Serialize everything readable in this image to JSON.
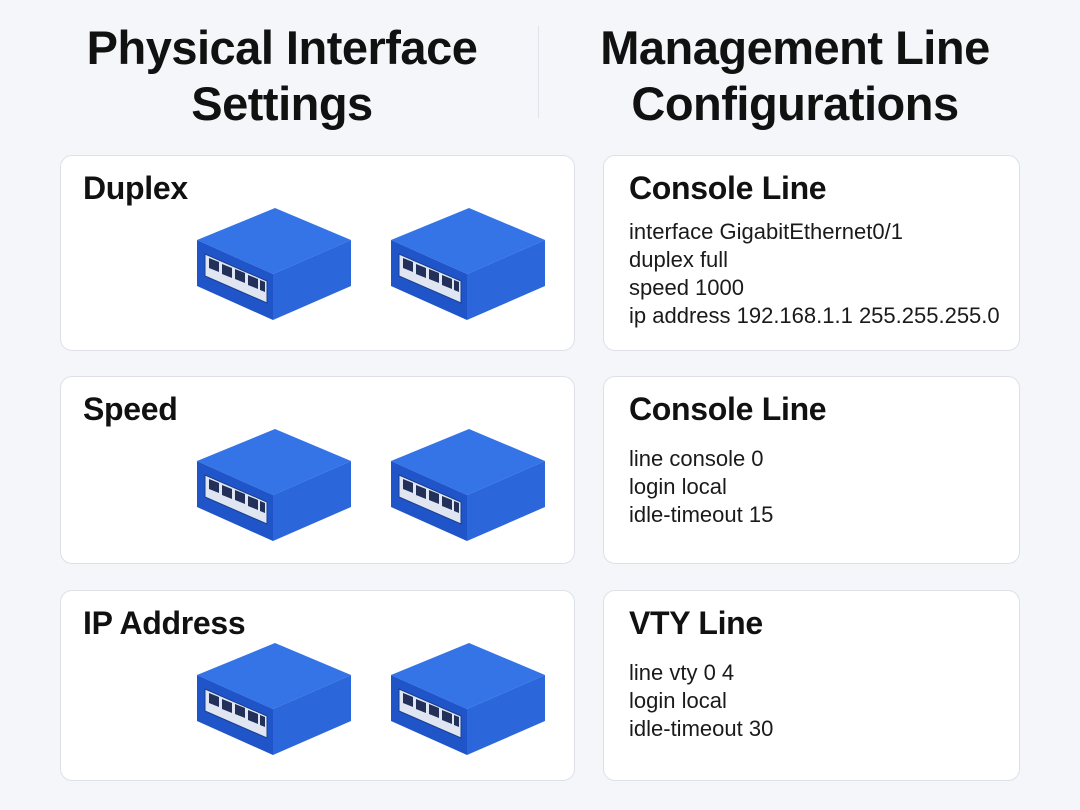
{
  "header": {
    "left_title_line1": "Physical Interface",
    "left_title_line2": "Settings",
    "right_title_line1": "Management Line",
    "right_title_line2": "Configurations"
  },
  "left_cards": [
    {
      "label": "Duplex",
      "icon": "network-switch-icon"
    },
    {
      "label": "Speed",
      "icon": "network-switch-icon"
    },
    {
      "label": "IP Address",
      "icon": "network-switch-icon"
    }
  ],
  "right_cards": [
    {
      "label": "Console Line",
      "lines": [
        "interface GigabitEthernet0/1",
        "duplex full",
        "speed 1000",
        "ip address 192.168.1.1 255.255.255.0"
      ]
    },
    {
      "label": "Console Line",
      "lines": [
        "line console 0",
        "login local",
        "idle-timeout 15"
      ]
    },
    {
      "label": "VTY Line",
      "lines": [
        "line vty 0 4",
        "login local",
        "idle-timeout 30"
      ]
    }
  ],
  "colors": {
    "switch_top": "#2f6fe0",
    "switch_front": "#1f52c4",
    "switch_side": "#2a62d8",
    "background": "#f4f6f9"
  }
}
